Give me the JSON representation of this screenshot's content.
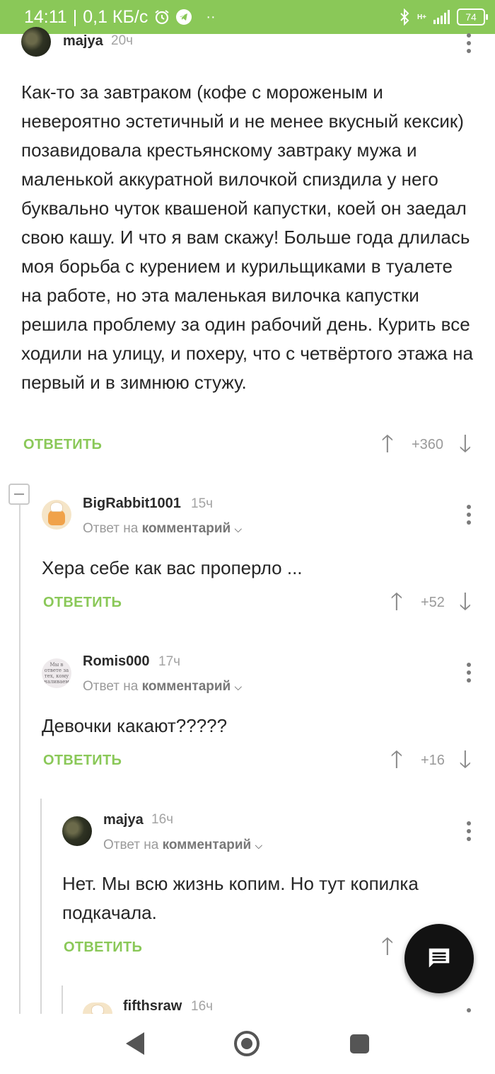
{
  "status_bar": {
    "time": "14:11",
    "separator": "|",
    "speed": "0,1 КБ/с",
    "dots": "··",
    "network_type": "H+",
    "battery": "74",
    "icons": [
      "alarm-icon",
      "telegram-icon",
      "bluetooth-icon",
      "signal-icon",
      "battery-icon"
    ]
  },
  "comments": [
    {
      "username": "majya",
      "time": "20ч",
      "text": "Как-то за завтраком (кофе с мороженым и невероятно эстетичный и не менее вкусный кексик) позавидовала крестьянскому завтраку мужа и маленькой аккуратной вилочкой спиздила у него буквально чуток квашеной капустки, коей он заедал свою кашу. И что я вам скажу! Больше года длилась моя борьба с курением и курильщиками в туалете на работе, но эта маленькая вилочка капустки решила проблему за один рабочий день. Курить все ходили на улицу, и похеру, что с четвёртого этажа на первый и в зимнюю стужу.",
      "reply_label": "ОТВЕТИТЬ",
      "score": "+360"
    },
    {
      "username": "BigRabbit1001",
      "time": "15ч",
      "reply_prefix": "Ответ на",
      "reply_target": "комментарий",
      "text": "Хера себе как вас проперло ...",
      "reply_label": "ОТВЕТИТЬ",
      "score": "+52"
    },
    {
      "username": "Romis000",
      "time": "17ч",
      "avatar_text": "Мы в ответе за тех, кому наливаем",
      "reply_prefix": "Ответ на",
      "reply_target": "комментарий",
      "text": "Девочки какают?????",
      "reply_label": "ОТВЕТИТЬ",
      "score": "+16"
    },
    {
      "username": "majya",
      "time": "16ч",
      "reply_prefix": "Ответ на",
      "reply_target": "комментарий",
      "text": "Нет. Мы всю жизнь копим. Но тут копилка подкачала.",
      "reply_label": "ОТВЕТИТЬ"
    },
    {
      "username": "fifthsraw",
      "time": "16ч"
    }
  ],
  "colors": {
    "accent": "#8ac858",
    "fab": "#121212"
  }
}
